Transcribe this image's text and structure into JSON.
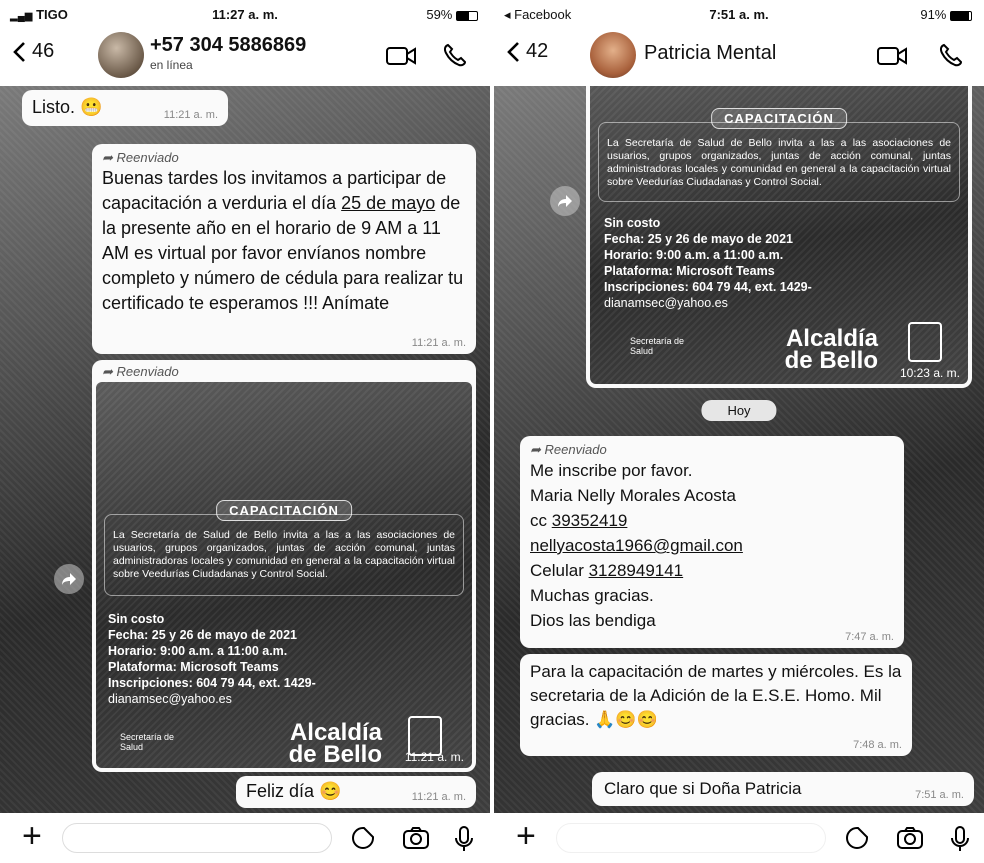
{
  "left": {
    "status": {
      "carrier": "TIGO",
      "time": "11:27 a. m.",
      "battery": "59%"
    },
    "header": {
      "back_count": "46",
      "title": "+57 304 5886869",
      "subtitle": "en línea"
    },
    "messages": {
      "listo": {
        "text": "Listo. 😬",
        "time": "11:21 a. m."
      },
      "forwarded_text": {
        "label": "Reenviado",
        "pre": "Buenas tardes los invitamos a participar de capacitación a verduria el día ",
        "date_link": "25 de mayo",
        "post": " de  la presente año en el horario de 9 AM a 11 AM es virtual por favor envíanos nombre completo y número de cédula para realizar tu certificado te esperamos !!! Anímate",
        "time": "11:21 a. m."
      },
      "forwarded_image": {
        "label": "Reenviado",
        "time": "11:21 a. m."
      },
      "feliz": {
        "text": "Feliz día 😊",
        "time": "11:21 a. m."
      }
    }
  },
  "poster": {
    "title": "CAPACITACIÓN",
    "body": "La Secretaría de Salud de Bello invita a las a las asociaciones de usuarios, grupos organizados, juntas de acción comunal, juntas administradoras locales y comunidad en general a la capacitación virtual sobre Veedurías Ciudadanas y Control Social.",
    "sin_costo": "Sin costo",
    "fecha": "Fecha: 25 y 26 de mayo de 2021",
    "horario": "Horario: 9:00 a.m. a 11:00 a.m.",
    "plataforma": "Plataforma: Microsoft Teams",
    "inscripciones": "Inscripciones: 604 79 44, ext. 1429-",
    "email": "dianamsec@yahoo.es",
    "secretaria": "Secretaría de Salud",
    "logo_line1": "Alcaldía",
    "logo_line2": "de Bello"
  },
  "right": {
    "status": {
      "carrier": "◂ Facebook",
      "time": "7:51 a. m.",
      "battery": "91%"
    },
    "header": {
      "back_count": "42",
      "title": "Patricia Mental"
    },
    "messages": {
      "image_time": "10:23 a. m.",
      "date_pill": "Hoy",
      "inscripcion": {
        "label": "Reenviado",
        "line1": "Me inscribe por favor.",
        "line2": "Maria Nelly Morales Acosta",
        "cc_prefix": "cc ",
        "cc": "39352419",
        "email": "nellyacosta1966@gmail.con",
        "celular_prefix": "Celular ",
        "celular": "3128949141",
        "line6": "Muchas gracias.",
        "line7": "Dios las bendiga",
        "time": "7:47 a. m."
      },
      "para": {
        "text": "Para la capacitación de martes y miércoles. Es la secretaria de la Adición de la E.S.E. Homo. Mil gracias. 🙏😊😊",
        "time": "7:48 a. m."
      },
      "claro": {
        "text": "Claro que si Doña Patricia",
        "time": "7:51 a. m."
      }
    }
  },
  "colors": {
    "bubble": "#fafafa",
    "wallpaper": "#3d3d3d",
    "poster_bg": "#2b2b2b"
  },
  "icons": [
    "signal-icon",
    "battery-icon",
    "back-chevron-icon",
    "video-call-icon",
    "phone-icon",
    "share-icon",
    "plus-icon",
    "sticker-icon",
    "camera-icon",
    "microphone-icon"
  ]
}
